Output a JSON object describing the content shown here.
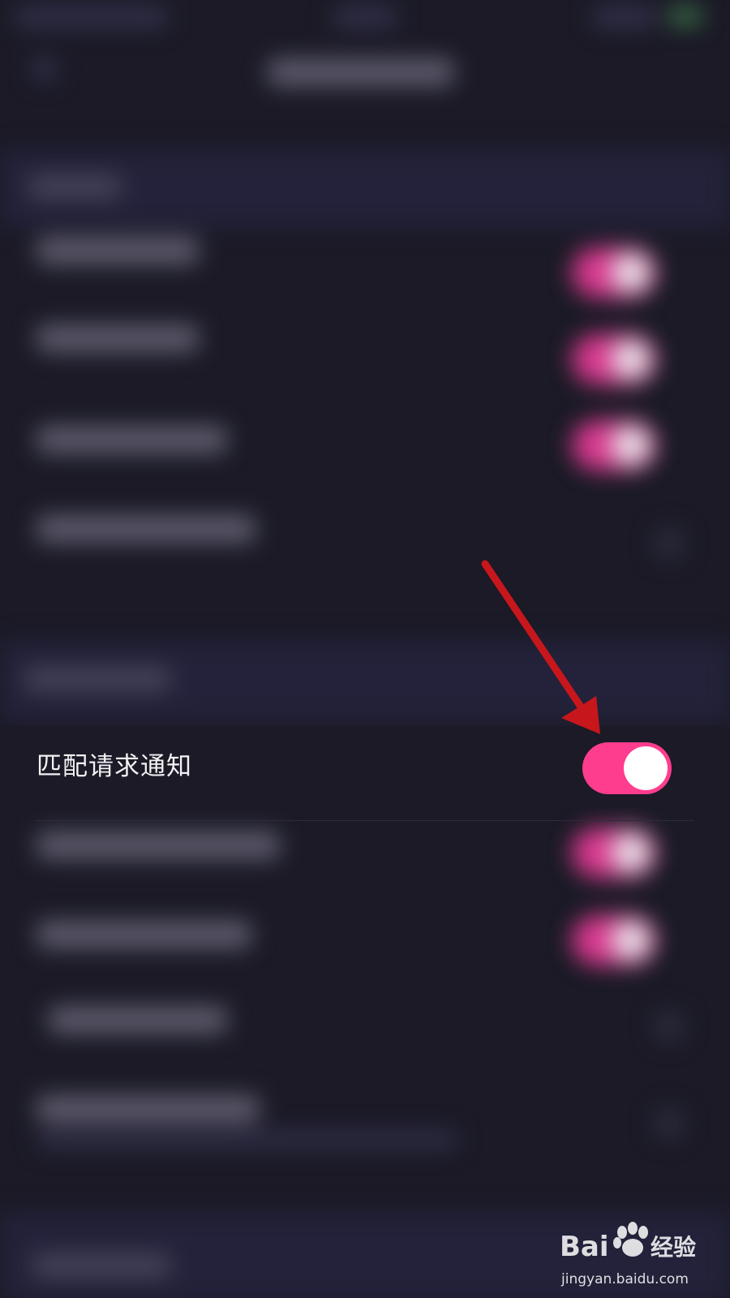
{
  "row": {
    "label": "匹配请求通知",
    "toggle_on": true
  },
  "colors": {
    "background": "#1b1a26",
    "toggle_on": "#ff3d8e",
    "arrow": "#c8161d"
  },
  "watermark": {
    "brand": "Bai经验",
    "url": "jingyan.baidu.com"
  }
}
